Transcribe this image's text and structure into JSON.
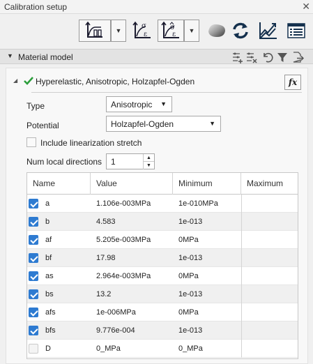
{
  "window": {
    "title": "Calibration setup",
    "close_glyph": "✕"
  },
  "toolbar": {
    "icons": [
      "plot-settings-icon",
      "sigma-epsilon-icon",
      "sigma-hat-epsilon-icon",
      "material-shape-icon",
      "refresh-icon",
      "trend-chart-icon",
      "form-list-icon"
    ],
    "dropdown_glyph": "▼"
  },
  "section": {
    "arrow": "▼",
    "label": "Material model",
    "icons": [
      "add-parameter-icon",
      "remove-parameter-icon",
      "reset-icon",
      "filter-icon",
      "export-icon"
    ]
  },
  "model": {
    "expand_glyph": "◢",
    "label": "Hyperelastic, Anisotropic, Holzapfel-Ogden",
    "fx_label": "fx",
    "accent": "#2a9d3a"
  },
  "form": {
    "type_label": "Type",
    "type_value": "Anisotropic",
    "potential_label": "Potential",
    "potential_value": "Holzapfel-Ogden",
    "linearization_label": "Include linearization stretch",
    "linearization_checked": false,
    "num_dirs_label": "Num local directions",
    "num_dirs_value": "1",
    "caret": "▼",
    "spin_up": "▲",
    "spin_down": "▼"
  },
  "table": {
    "headers": [
      "Name",
      "Value",
      "Minimum",
      "Maximum"
    ],
    "rows": [
      {
        "checked": true,
        "name": "a",
        "value": "1.106e-003MPa",
        "minimum": "1e-010MPa",
        "maximum": ""
      },
      {
        "checked": true,
        "name": "b",
        "value": "4.583",
        "minimum": "1e-013",
        "maximum": ""
      },
      {
        "checked": true,
        "name": "af",
        "value": "5.205e-003MPa",
        "minimum": "0MPa",
        "maximum": ""
      },
      {
        "checked": true,
        "name": "bf",
        "value": "17.98",
        "minimum": "1e-013",
        "maximum": ""
      },
      {
        "checked": true,
        "name": "as",
        "value": "2.964e-003MPa",
        "minimum": "0MPa",
        "maximum": ""
      },
      {
        "checked": true,
        "name": "bs",
        "value": "13.2",
        "minimum": "1e-013",
        "maximum": ""
      },
      {
        "checked": true,
        "name": "afs",
        "value": "1e-006MPa",
        "minimum": "0MPa",
        "maximum": ""
      },
      {
        "checked": true,
        "name": "bfs",
        "value": "9.776e-004",
        "minimum": "1e-013",
        "maximum": ""
      },
      {
        "checked": false,
        "name": "D",
        "value": "0_MPa",
        "minimum": "0_MPa",
        "maximum": ""
      }
    ],
    "checkbox_color": "#2e7bd1"
  }
}
